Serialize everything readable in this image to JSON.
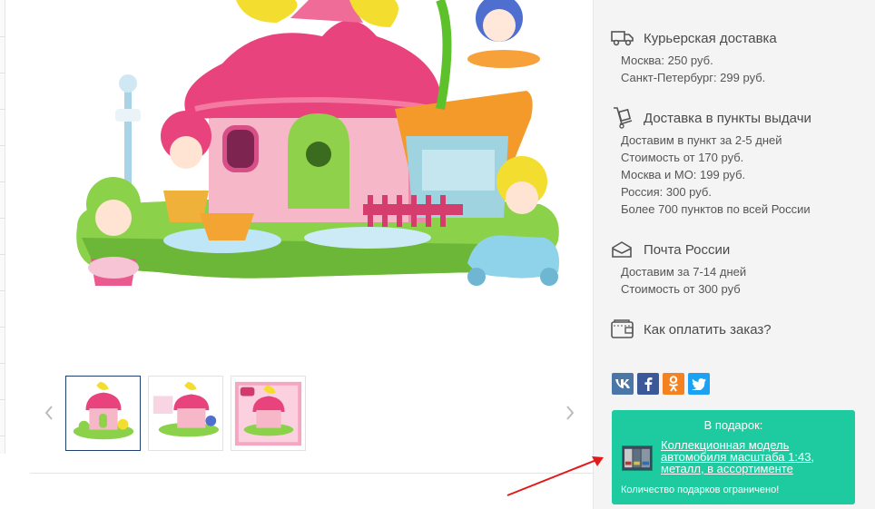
{
  "delivery": {
    "courier": {
      "title": "Курьерская доставка",
      "icon": "truck-icon",
      "lines": [
        "Москва: 250 руб.",
        "Санкт-Петербург: 299 руб."
      ]
    },
    "pickup": {
      "title": "Доставка в пункты выдачи",
      "icon": "hand-truck-icon",
      "lines": [
        "Доставим в пункт за 2-5 дней",
        "Стоимость от 170 руб.",
        "Москва и МО: 199 руб.",
        "Россия: 300 руб.",
        "Более 700 пунктов по всей России"
      ]
    },
    "post": {
      "title": "Почта России",
      "icon": "mail-envelope-icon",
      "lines": [
        "Доставим за 7-14 дней",
        "Стоимость от 300 руб"
      ]
    },
    "payment": {
      "title": "Как оплатить заказ?",
      "icon": "wallet-icon"
    }
  },
  "social": [
    {
      "name": "vk",
      "label": "vk",
      "color": "#4a76a8"
    },
    {
      "name": "facebook",
      "label": "f",
      "color": "#3b5998"
    },
    {
      "name": "odnoklassniki",
      "label": "ok",
      "color": "#f58220"
    },
    {
      "name": "twitter",
      "label": "tw",
      "color": "#1da1f2"
    }
  ],
  "gift": {
    "heading": "В подарок:",
    "item_link": "Коллекционная модель автомобиля масштаба 1:43, металл, в ассортименте",
    "note": "Количество подарков ограничено!",
    "bg_color": "#1ecba0"
  },
  "gallery": {
    "thumbnails": [
      "playset-front",
      "playset-angle",
      "playset-box"
    ],
    "active_index": 0
  },
  "annotation": {
    "arrow_color": "#e01b1b"
  }
}
